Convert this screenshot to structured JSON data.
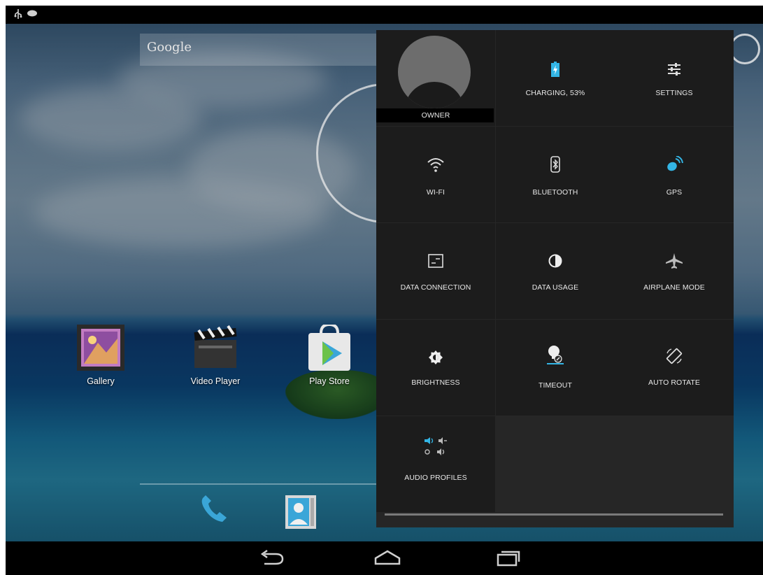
{
  "desktop": {
    "search_label": "Google",
    "apps": [
      {
        "label": "Gallery",
        "icon": "gallery-icon"
      },
      {
        "label": "Video Player",
        "icon": "clapperboard-icon"
      },
      {
        "label": "Play Store",
        "icon": "play-store-icon"
      }
    ],
    "dock": [
      {
        "icon": "phone-icon"
      },
      {
        "icon": "contacts-icon"
      }
    ]
  },
  "status_bar": {
    "icons": [
      "usb-icon",
      "battery-icon"
    ]
  },
  "quick_settings": {
    "tiles": [
      {
        "label": "OWNER",
        "icon": "user-avatar-icon"
      },
      {
        "label": "CHARGING, 53%",
        "icon": "battery-charging-icon",
        "battery_level_percent": 53
      },
      {
        "label": "SETTINGS",
        "icon": "settings-sliders-icon"
      },
      {
        "label": "WI-FI",
        "icon": "wifi-icon"
      },
      {
        "label": "BLUETOOTH",
        "icon": "bluetooth-icon"
      },
      {
        "label": "GPS",
        "icon": "gps-icon",
        "active": true
      },
      {
        "label": "DATA CONNECTION",
        "icon": "data-connection-icon"
      },
      {
        "label": "DATA USAGE",
        "icon": "data-usage-icon"
      },
      {
        "label": "AIRPLANE MODE",
        "icon": "airplane-icon"
      },
      {
        "label": "BRIGHTNESS",
        "icon": "brightness-icon"
      },
      {
        "label": "TIMEOUT",
        "icon": "timeout-icon"
      },
      {
        "label": "AUTO ROTATE",
        "icon": "auto-rotate-icon"
      },
      {
        "label": "AUDIO PROFILES",
        "icon": "audio-profiles-icon"
      }
    ]
  },
  "navigation": {
    "buttons": [
      "back-icon",
      "home-icon",
      "recents-icon"
    ]
  },
  "colors": {
    "accent": "#33b5e5",
    "panel": "#262626",
    "tile": "#1c1c1c"
  }
}
